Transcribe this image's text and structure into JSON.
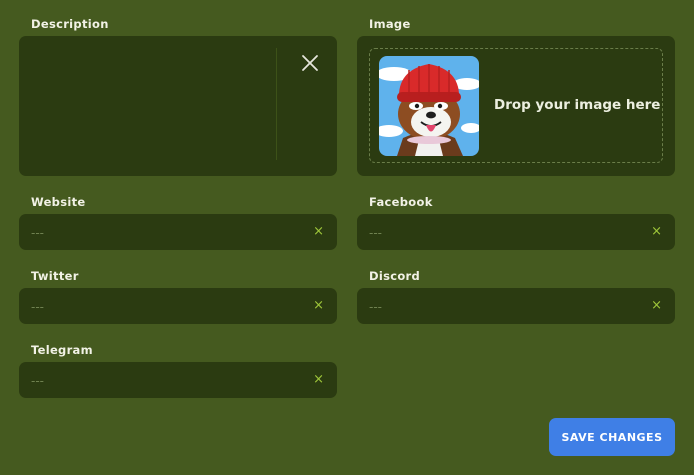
{
  "description": {
    "label": "Description",
    "value": ""
  },
  "image": {
    "label": "Image",
    "drop_text": "Drop your image here"
  },
  "fields": {
    "website": {
      "label": "Website",
      "placeholder": "---",
      "clear_icon": "×"
    },
    "facebook": {
      "label": "Facebook",
      "placeholder": "---",
      "clear_icon": "×"
    },
    "twitter": {
      "label": "Twitter",
      "placeholder": "---",
      "clear_icon": "×"
    },
    "discord": {
      "label": "Discord",
      "placeholder": "---",
      "clear_icon": "×"
    },
    "telegram": {
      "label": "Telegram",
      "placeholder": "---",
      "clear_icon": "×"
    }
  },
  "actions": {
    "save_label": "SAVE CHANGES"
  },
  "colors": {
    "background": "#455a1f",
    "field": "#2b3b11",
    "accent_clear": "#9fc73a",
    "button": "#3f7fe6"
  }
}
